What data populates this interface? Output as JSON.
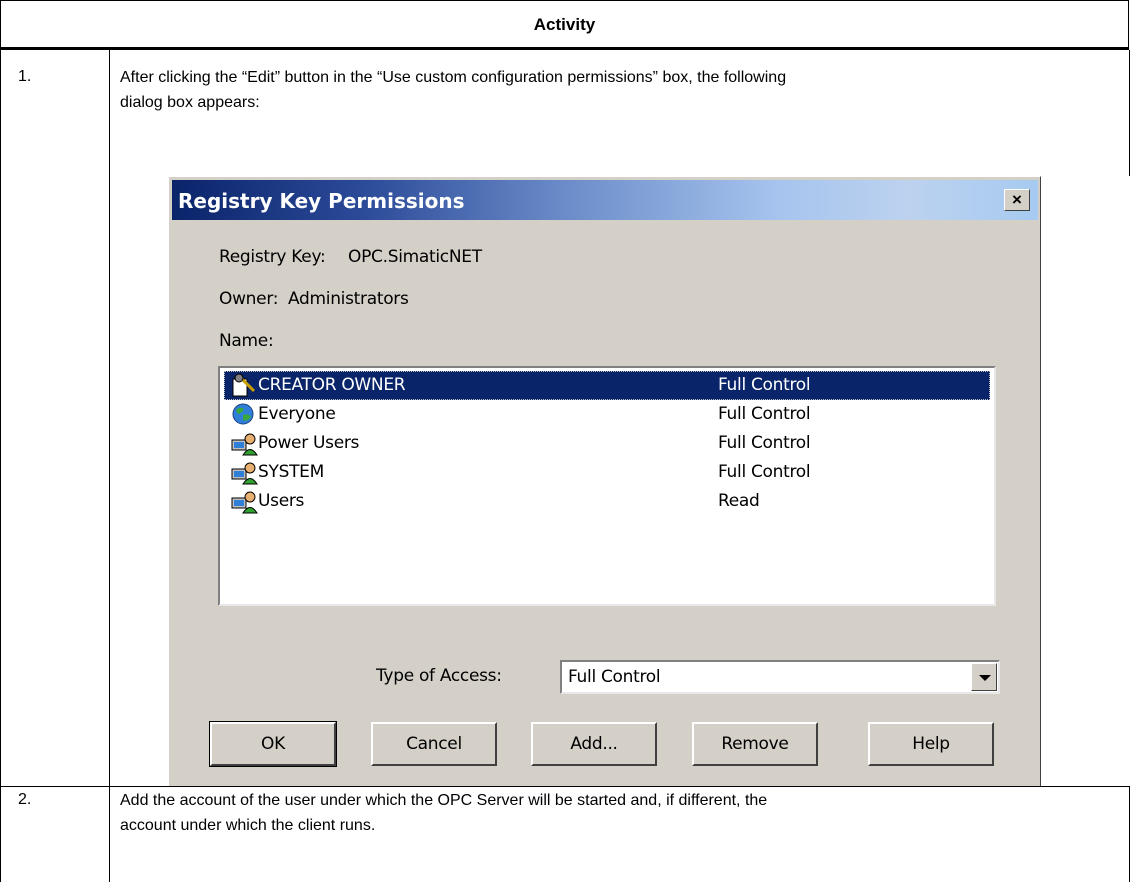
{
  "table": {
    "header": "Activity",
    "steps": [
      {
        "num": "1.",
        "text_line1": "After clicking the “Edit” button in the “Use custom configuration permissions” box, the following",
        "text_line2": "dialog box appears:"
      },
      {
        "num": "2.",
        "text_line1": "Add the account of the user under which the OPC Server will be started and, if different, the",
        "text_line2": "account under which the client runs."
      }
    ]
  },
  "dialog": {
    "title": "Registry Key Permissions",
    "close_label": "×",
    "registry_key_label": "Registry Key:",
    "registry_key_value": "OPC.SimaticNET",
    "owner_label": "Owner:",
    "owner_value": "Administrators",
    "name_label": "Name:",
    "entries": [
      {
        "name": "CREATOR OWNER",
        "access": "Full Control",
        "icon": "creator-owner-icon",
        "selected": true
      },
      {
        "name": "Everyone",
        "access": "Full Control",
        "icon": "globe-icon",
        "selected": false
      },
      {
        "name": "Power Users",
        "access": "Full Control",
        "icon": "users-group-icon",
        "selected": false
      },
      {
        "name": "SYSTEM",
        "access": "Full Control",
        "icon": "users-group-icon",
        "selected": false
      },
      {
        "name": "Users",
        "access": "Read",
        "icon": "users-group-icon",
        "selected": false
      }
    ],
    "type_of_access_label": "Type of Access:",
    "type_of_access_value": "Full Control",
    "buttons": {
      "ok": "OK",
      "cancel": "Cancel",
      "add": "Add...",
      "remove": "Remove",
      "help": "Help"
    },
    "colors": {
      "face": "#d4d0c8",
      "title_start": "#0a246a",
      "title_end": "#a6caf0",
      "selection": "#0a246a"
    }
  }
}
